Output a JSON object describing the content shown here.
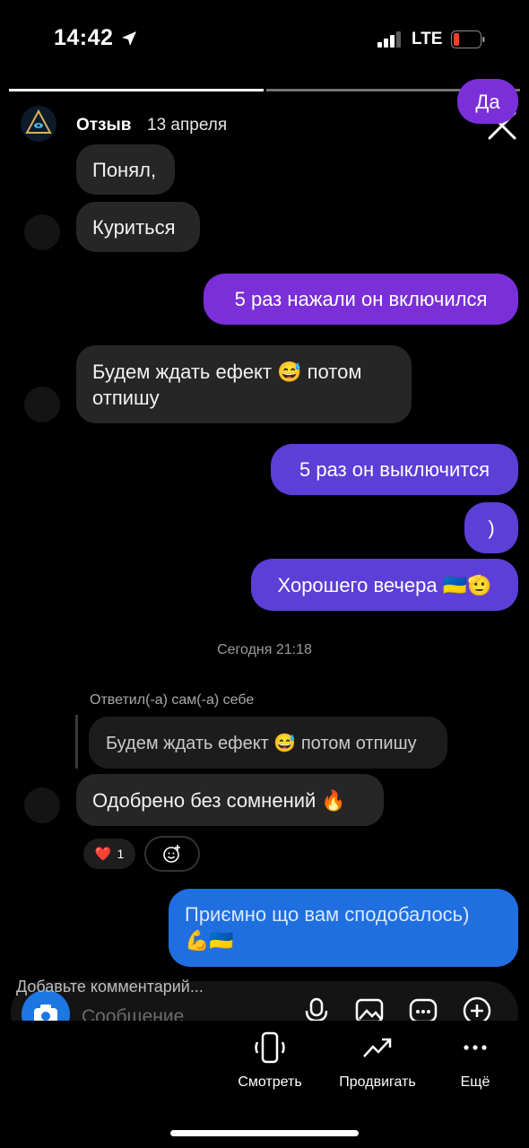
{
  "status_bar": {
    "time": "14:42",
    "network": "LTE",
    "battery_color": "#ff3b30"
  },
  "story": {
    "username": "Отзыв",
    "date": "13 апреля",
    "progress": {
      "segments": 2,
      "current": 1
    }
  },
  "chat": {
    "top_partial": "Да",
    "messages": [
      {
        "side": "in",
        "text": "Понял,"
      },
      {
        "side": "in",
        "text": "Куриться"
      },
      {
        "side": "out",
        "text": "5 раз нажали он включился"
      },
      {
        "side": "in",
        "text": "Будем ждать ефект 😅 потом",
        "text2": "отпишу"
      },
      {
        "side": "out",
        "text": "5 раз он выключится"
      },
      {
        "side": "out",
        "text": ")"
      },
      {
        "side": "out",
        "text": "Хорошего вечера 🇺🇦🫡"
      }
    ],
    "date_separator": "Сегодня 21:18",
    "reply_label": "Ответил(-а) сам(-а) себе",
    "quoted": "Будем ждать ефект 😅 потом отпишу",
    "approved": "Одобрено без сомнений 🔥",
    "reaction": {
      "emoji": "❤️",
      "count": "1"
    },
    "final_out": {
      "line1": "Приємно що вам сподобалось)",
      "line2": "💪🇺🇦"
    }
  },
  "composer": {
    "comment_label": "Добавьте комментарий...",
    "placeholder": "Сообщение"
  },
  "bottom_nav": [
    {
      "label": "Смотреть",
      "icon": "phone-rotate-icon"
    },
    {
      "label": "Продвигать",
      "icon": "trend-up-icon"
    },
    {
      "label": "Ещё",
      "icon": "more-dots-icon"
    }
  ],
  "colors": {
    "outgoing": "#7b2fd9",
    "incoming": "#262626",
    "highlight": "#1f6fe0"
  }
}
